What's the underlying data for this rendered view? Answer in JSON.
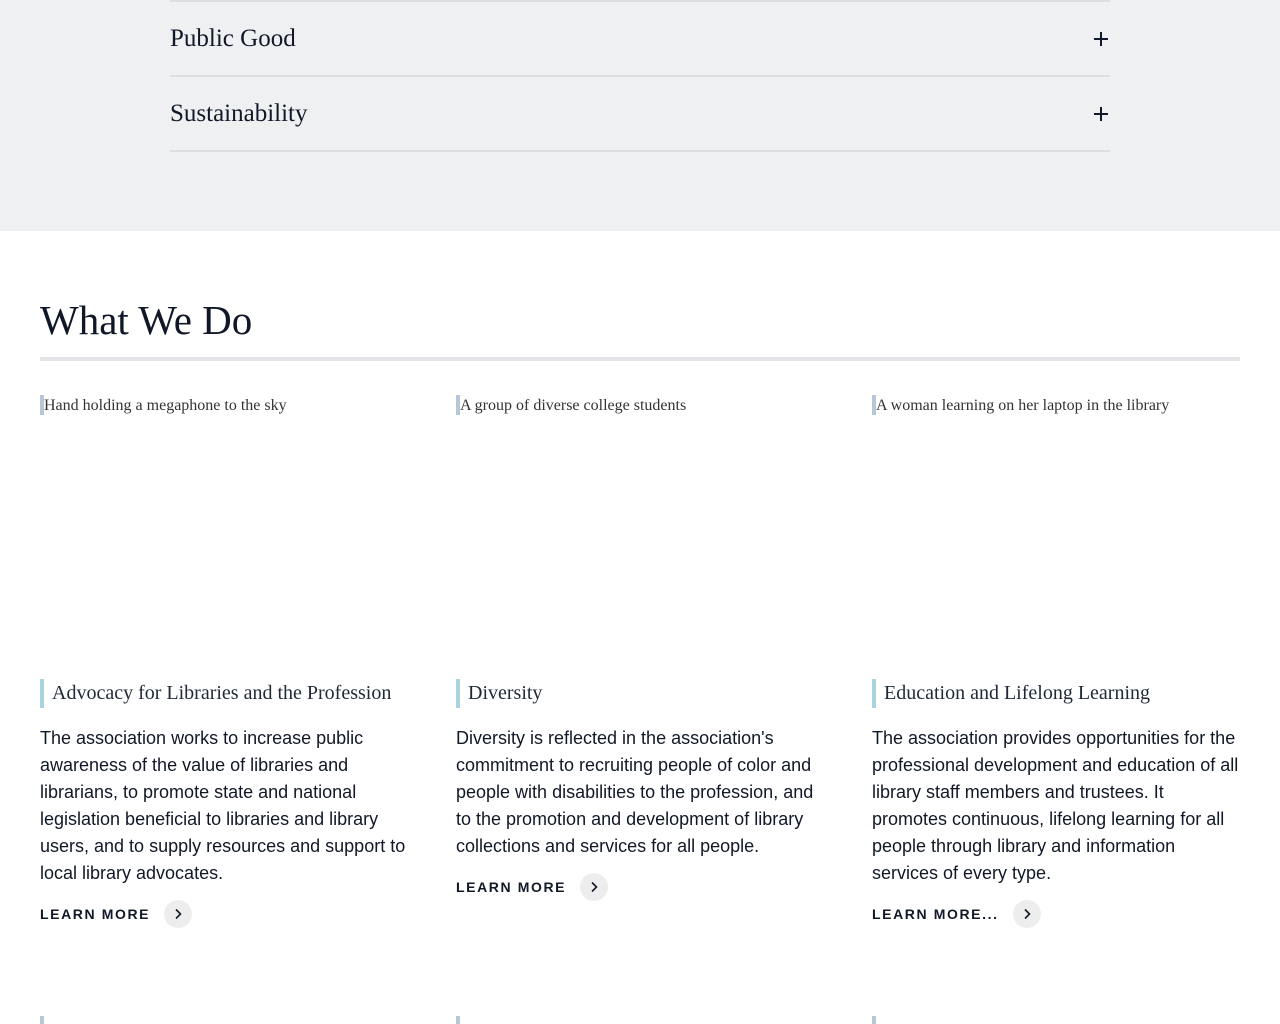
{
  "accordion": {
    "items": [
      {
        "label": "Public Good"
      },
      {
        "label": "Sustainability"
      }
    ]
  },
  "what_we_do": {
    "title": "What We Do",
    "cards": [
      {
        "image_alt": "Hand holding a megaphone to the sky",
        "heading": "Advocacy for Libraries and the Profession",
        "description": "The association works to increase public awareness of the value of libraries and librarians, to promote state and national legislation beneficial to libraries and library users, and to supply resources and support to local library advocates.",
        "link_label": "LEARN MORE"
      },
      {
        "image_alt": "A group of diverse college students",
        "heading": "Diversity",
        "description": "Diversity is reflected in the association's commitment to recruiting people of color and people with disabilities to the profession, and to the promotion and development of library collections and services for all people.",
        "link_label": "LEARN MORE"
      },
      {
        "image_alt": "A woman learning on her laptop in the library",
        "heading": "Education and Lifelong Learning",
        "description": "The association provides opportunities for the professional development and education of all library staff members and trustees. It promotes continuous, lifelong learning for all people through library and information services of every type.",
        "link_label": "LEARN MORE..."
      }
    ]
  },
  "icons": {
    "accordion_toggle": "plus-icon",
    "learn_more": "chevron-right-icon"
  }
}
